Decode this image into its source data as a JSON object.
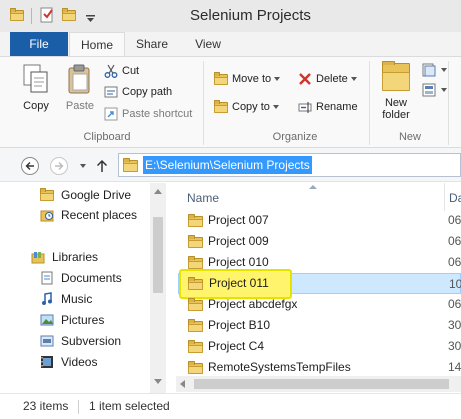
{
  "window": {
    "title": "Selenium Projects"
  },
  "ribbon_tabs": [
    {
      "label": "File"
    },
    {
      "label": "Home"
    },
    {
      "label": "Share"
    },
    {
      "label": "View"
    }
  ],
  "clipboard": {
    "copy": "Copy",
    "paste": "Paste",
    "cut": "Cut",
    "copy_path": "Copy path",
    "paste_shortcut": "Paste shortcut",
    "group_label": "Clipboard"
  },
  "organize": {
    "move_to": "Move to",
    "copy_to": "Copy to",
    "delete": "Delete",
    "rename": "Rename",
    "group_label": "Organize"
  },
  "new_group": {
    "new_folder_line1": "New",
    "new_folder_line2": "folder",
    "group_label": "New"
  },
  "address": {
    "path": "E:\\Selenium\\Selenium Projects"
  },
  "nav_pane": {
    "favorites": [
      {
        "label": "Google Drive",
        "icon": "google-drive-icon"
      },
      {
        "label": "Recent places",
        "icon": "recent-places-icon"
      }
    ],
    "libraries_label": "Libraries",
    "libraries": [
      {
        "label": "Documents",
        "icon": "documents-icon"
      },
      {
        "label": "Music",
        "icon": "music-icon"
      },
      {
        "label": "Pictures",
        "icon": "pictures-icon"
      },
      {
        "label": "Subversion",
        "icon": "subversion-icon"
      },
      {
        "label": "Videos",
        "icon": "videos-icon"
      }
    ]
  },
  "file_list": {
    "columns": {
      "name": "Name",
      "date": "Da"
    },
    "rows": [
      {
        "name": "Project 007",
        "date": "06"
      },
      {
        "name": "Project 009",
        "date": "06"
      },
      {
        "name": "Project 010",
        "date": "06"
      },
      {
        "name": "Project 011",
        "date": "10"
      },
      {
        "name": "Project abcdefgx",
        "date": "06"
      },
      {
        "name": "Project B10",
        "date": "30"
      },
      {
        "name": "Project C4",
        "date": "30"
      },
      {
        "name": "RemoteSystemsTempFiles",
        "date": "14"
      }
    ],
    "selected_row": "Project 011",
    "highlight_color": "#fff46b"
  },
  "status": {
    "item_count": "23 items",
    "selection": "1 item selected"
  },
  "colors": {
    "file_tab": "#1a5ea8",
    "selection": "#cde8ff",
    "address_highlight": "#3399ff",
    "folder": "#e8c35a"
  }
}
